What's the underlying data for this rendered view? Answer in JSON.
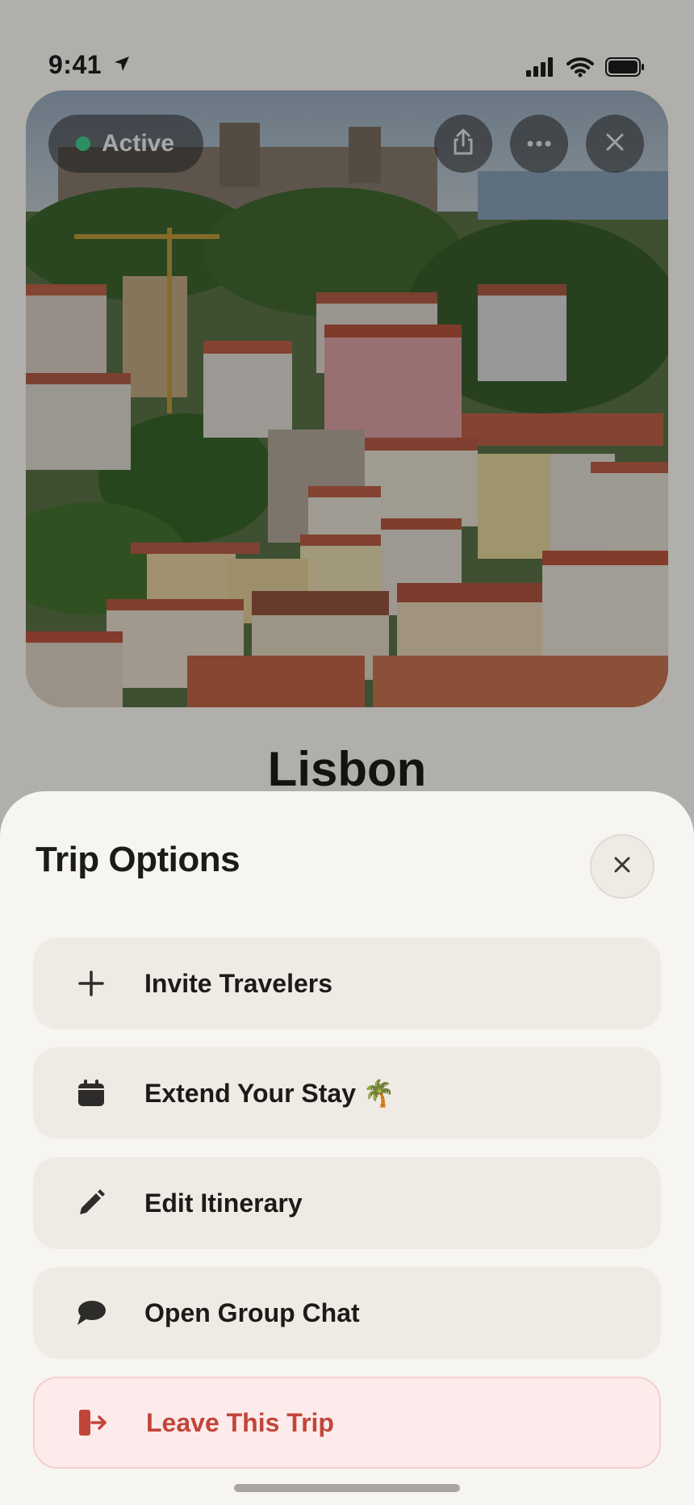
{
  "status_bar": {
    "time": "9:41"
  },
  "trip": {
    "status": "Active",
    "city": "Lisbon"
  },
  "sheet": {
    "title": "Trip Options",
    "options": [
      {
        "label": "Invite Travelers",
        "icon": "plus-icon"
      },
      {
        "label": "Extend Your Stay 🌴",
        "icon": "calendar-icon"
      },
      {
        "label": "Edit Itinerary",
        "icon": "pencil-icon"
      },
      {
        "label": "Open Group Chat",
        "icon": "chat-bubble-icon"
      },
      {
        "label": "Leave This Trip",
        "icon": "leave-icon"
      }
    ]
  },
  "colors": {
    "accent_active": "#3cc78a",
    "danger": "#c2453a",
    "sheet_bg": "#f7f5f1",
    "option_bg": "#efebe4"
  }
}
